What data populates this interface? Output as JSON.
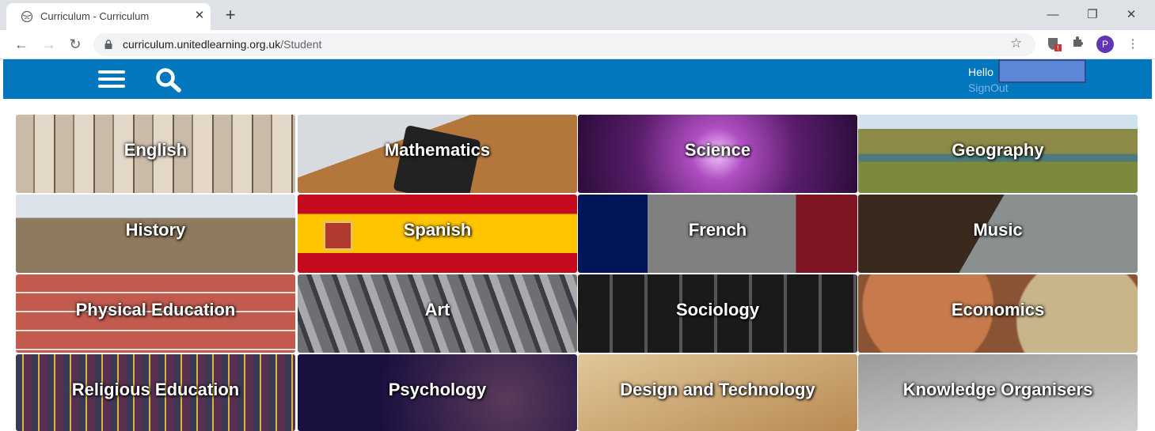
{
  "browser": {
    "tab_title": "Curriculum - Curriculum",
    "tab_close": "✕",
    "new_tab": "+",
    "url_host": "curriculum.unitedlearning.org.uk",
    "url_path": "/Student",
    "profile_initial": "P",
    "window_controls": {
      "minimize": "—",
      "restore": "❐",
      "close": "✕"
    }
  },
  "header": {
    "hello": "Hello",
    "signout": "SignOut",
    "accent_color": "#0277bd"
  },
  "subjects": [
    {
      "label": "English"
    },
    {
      "label": "Mathematics"
    },
    {
      "label": "Science"
    },
    {
      "label": "Geography"
    },
    {
      "label": "History"
    },
    {
      "label": "Spanish"
    },
    {
      "label": "French"
    },
    {
      "label": "Music"
    },
    {
      "label": "Physical Education"
    },
    {
      "label": "Art"
    },
    {
      "label": "Sociology"
    },
    {
      "label": "Economics"
    },
    {
      "label": "Religious Education"
    },
    {
      "label": "Psychology"
    },
    {
      "label": "Design and Technology"
    },
    {
      "label": "Knowledge Organisers"
    }
  ]
}
